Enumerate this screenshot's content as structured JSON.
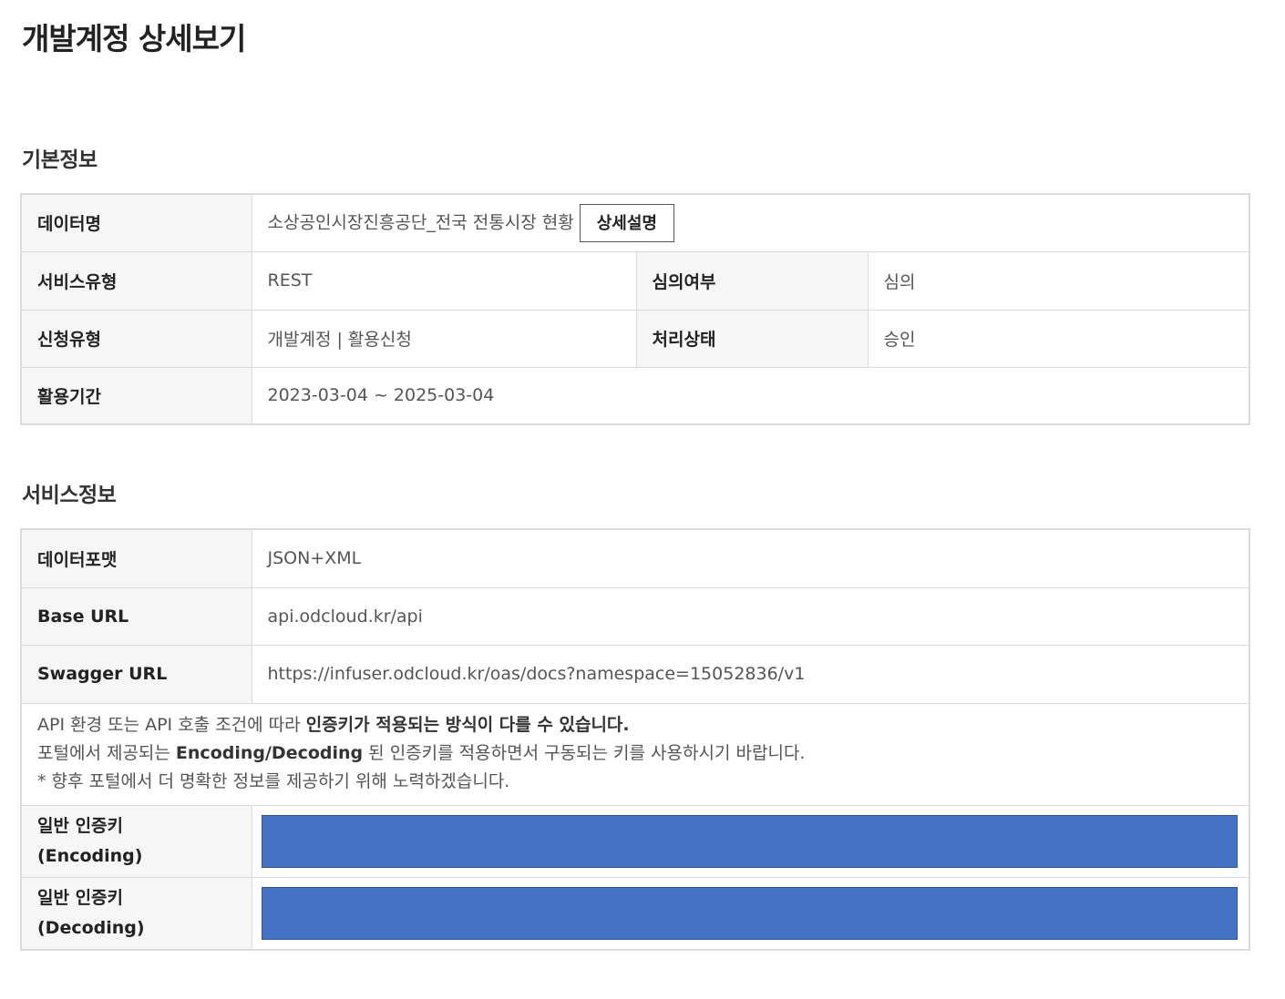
{
  "page": {
    "title": "개발계정 상세보기"
  },
  "basic_info": {
    "section_title": "기본정보",
    "rows": {
      "data_name": {
        "label": "데이터명",
        "value": "소상공인시장진흥공단_전국 전통시장 현황",
        "button": "상세설명"
      },
      "service_type": {
        "label": "서비스유형",
        "value": "REST"
      },
      "review": {
        "label": "심의여부",
        "value": "심의"
      },
      "request_type": {
        "label": "신청유형",
        "value": "개발계정 | 활용신청"
      },
      "status": {
        "label": "처리상태",
        "value": "승인"
      },
      "period": {
        "label": "활용기간",
        "value": "2023-03-04 ~ 2025-03-04"
      }
    }
  },
  "service_info": {
    "section_title": "서비스정보",
    "rows": {
      "data_format": {
        "label": "데이터포맷",
        "value": "JSON+XML"
      },
      "base_url": {
        "label": "Base URL",
        "value": "api.odcloud.kr/api"
      },
      "swagger_url": {
        "label": "Swagger URL",
        "value": "https://infuser.odcloud.kr/oas/docs?namespace=15052836/v1"
      }
    },
    "notice": {
      "line1_prefix": "API 환경 또는 API 호출 조건에 따라 ",
      "line1_bold": "인증키가 적용되는 방식이 다를 수 있습니다.",
      "line2_prefix": "포털에서 제공되는 ",
      "line2_bold": "Encoding/Decoding",
      "line2_suffix": " 된 인증키를 적용하면서 구동되는 키를 사용하시기 바랍니다.",
      "line3": "* 향후 포털에서 더 명확한 정보를 제공하기 위해 노력하겠습니다."
    },
    "keys": {
      "encoding": {
        "label_line1": "일반 인증키",
        "label_line2": "(Encoding)"
      },
      "decoding": {
        "label_line1": "일반 인증키",
        "label_line2": "(Decoding)"
      }
    }
  },
  "colors": {
    "redaction": "#4472c4",
    "header_bg": "#f6f6f6",
    "border": "#dcdcdc"
  }
}
